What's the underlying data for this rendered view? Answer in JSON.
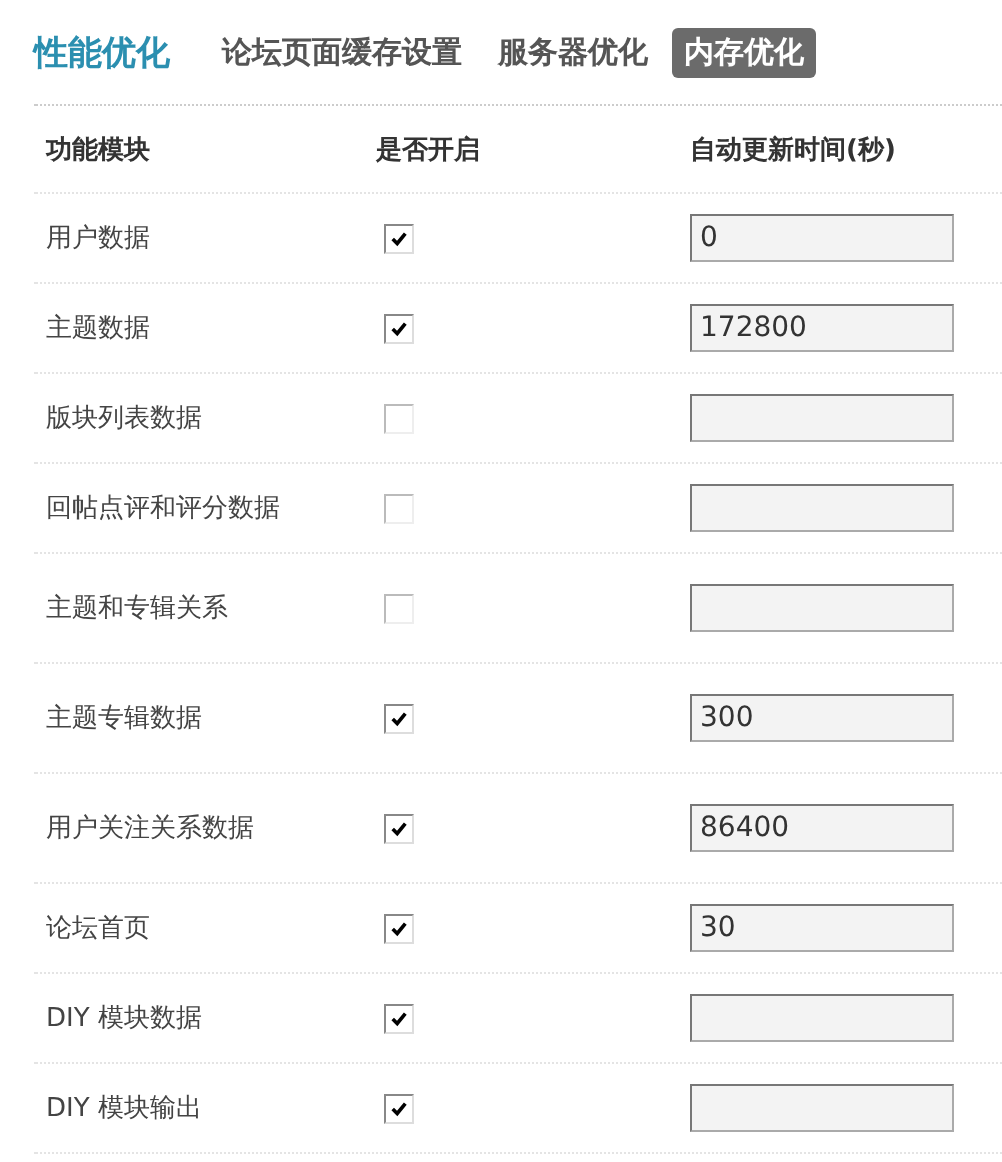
{
  "title": "性能优化",
  "tabs": [
    {
      "label": "论坛页面缓存设置",
      "selected": false
    },
    {
      "label": "服务器优化",
      "selected": false
    },
    {
      "label": "内存优化",
      "selected": true
    }
  ],
  "table": {
    "columns": [
      "功能模块",
      "是否开启",
      "自动更新时间(秒)"
    ],
    "rows": [
      {
        "name": "用户数据",
        "checked": true,
        "value": "0"
      },
      {
        "name": "主题数据",
        "checked": true,
        "value": "172800"
      },
      {
        "name": "版块列表数据",
        "checked": false,
        "value": ""
      },
      {
        "name": "回帖点评和评分数据",
        "checked": false,
        "value": ""
      },
      {
        "name": "主题和专辑关系",
        "checked": false,
        "value": ""
      },
      {
        "name": "主题专辑数据",
        "checked": true,
        "value": "300"
      },
      {
        "name": "用户关注关系数据",
        "checked": true,
        "value": "86400"
      },
      {
        "name": "论坛首页",
        "checked": true,
        "value": "30"
      },
      {
        "name": "DIY 模块数据",
        "checked": true,
        "value": ""
      },
      {
        "name": "DIY 模块输出",
        "checked": true,
        "value": ""
      }
    ]
  }
}
